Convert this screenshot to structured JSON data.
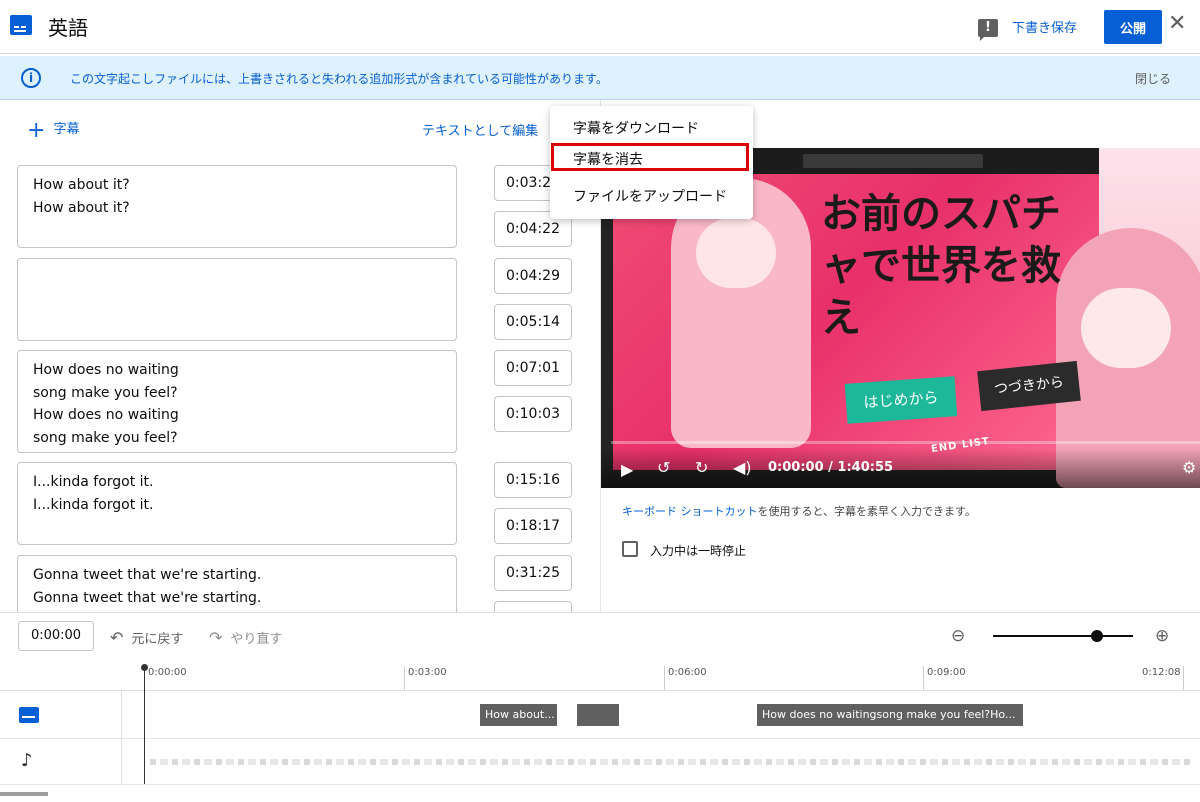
{
  "header": {
    "title": "英語",
    "feedback_icon": "feedback-icon",
    "save_draft": "下書き保存",
    "publish": "公開",
    "close": "✕"
  },
  "banner": {
    "icon": "info-icon",
    "text": "この文字起こしファイルには、上書きされると失われる追加形式が含まれている可能性があります。",
    "dismiss": "閉じる"
  },
  "editor": {
    "add_subtitle": "字幕",
    "edit_as_text": "テキストとして編集",
    "cues": [
      {
        "lines": [
          "How about it?",
          "How about it?"
        ],
        "start": "0:03:25",
        "end": "0:04:22"
      },
      {
        "lines": [],
        "start": "0:04:29",
        "end": "0:05:14"
      },
      {
        "lines": [
          "How does no waiting",
          "song make you feel?",
          "How does no waiting",
          "song make you feel?"
        ],
        "start": "0:07:01",
        "end": "0:10:03"
      },
      {
        "lines": [
          "I...kinda forgot it.",
          "I...kinda forgot it."
        ],
        "start": "0:15:16",
        "end": "0:18:17"
      },
      {
        "lines": [
          "Gonna tweet that we're starting.",
          "Gonna tweet that we're starting."
        ],
        "start": "0:31:25",
        "end": ""
      }
    ]
  },
  "menu": {
    "items": [
      "字幕をダウンロード",
      "字幕を消去",
      "ファイルをアップロード"
    ],
    "highlighted_index": 1,
    "highlight_color": "#dd0000"
  },
  "video": {
    "title_art": "お前のスパチャで世界を救え",
    "button_start": "はじめから",
    "button_continue": "つづきから",
    "end_list": "END LIST",
    "time": "0:00:00 / 1:40:55"
  },
  "help": {
    "shortcut_link": "キーボード ショートカット",
    "shortcut_rest": "を使用すると、字幕を素早く入力できます。",
    "pause_label": "入力中は一時停止",
    "pause_checked": false
  },
  "timeline": {
    "current_time": "0:00:00",
    "undo": "元に戻す",
    "redo": "やり直す",
    "zoom_level": 0.75,
    "ticks": [
      "0:00:00",
      "0:03:00",
      "0:06:00",
      "0:09:00",
      "0:12:08"
    ],
    "blocks": [
      "How about...",
      "",
      "How does no waitingsong make you feel?Ho..."
    ]
  },
  "colors": {
    "accent": "#065fd4",
    "banner_bg": "#def1ff"
  }
}
